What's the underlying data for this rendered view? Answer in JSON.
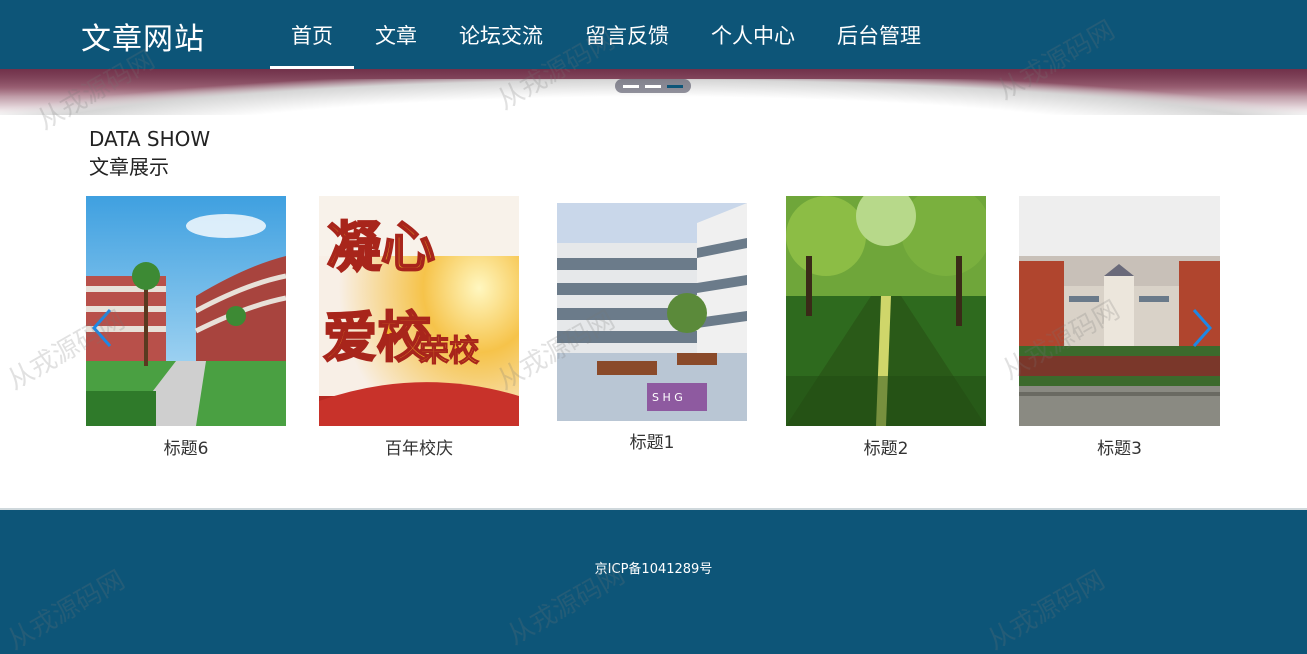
{
  "header": {
    "logo": "文章网站",
    "nav": [
      "首页",
      "文章",
      "论坛交流",
      "留言反馈",
      "个人中心",
      "后台管理"
    ]
  },
  "section": {
    "title_en": "DATA SHOW",
    "title_zh": "文章展示"
  },
  "cards": [
    {
      "caption": "标题6"
    },
    {
      "caption": "百年校庆"
    },
    {
      "caption": "标题1"
    },
    {
      "caption": "标题2"
    },
    {
      "caption": "标题3"
    }
  ],
  "carousel": {
    "prev_icon": "chevron-left-icon",
    "next_icon": "chevron-right-icon"
  },
  "footer": {
    "icp": "京ICP备1041289号"
  },
  "watermark": "从戎源码网",
  "colors": {
    "primary": "#0d5578",
    "accent": "#1e88e5"
  }
}
